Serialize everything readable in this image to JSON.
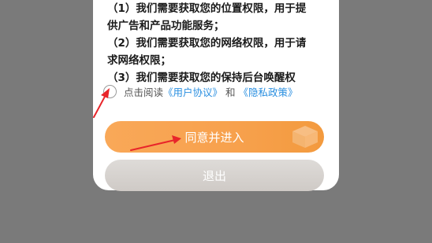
{
  "permissions": {
    "line1": "（1）我们需要获取您的位置权限，用于提",
    "line2": "供广告和产品功能服务；",
    "line3": "（2）我们需要获取您的网络权限，用于请",
    "line4": "求网络权限；",
    "line5": "（3）我们需要获取您的保持后台唤醒权"
  },
  "agreement": {
    "prefix": "点击阅读",
    "user_agreement": "《用户协议》",
    "and": "和",
    "privacy_policy": "《隐私政策》"
  },
  "buttons": {
    "agree_label": "同意并进入",
    "exit_label": "退出"
  },
  "colors": {
    "overlay": "#7a7a7a",
    "link": "#2a8fe0",
    "agree_button": "#f7a14d",
    "exit_button": "#d6d2ce",
    "annotation_arrow": "#e8252a"
  },
  "icons": {
    "agree_button_decoration": "box-icon",
    "annotation": "arrow-icon"
  }
}
